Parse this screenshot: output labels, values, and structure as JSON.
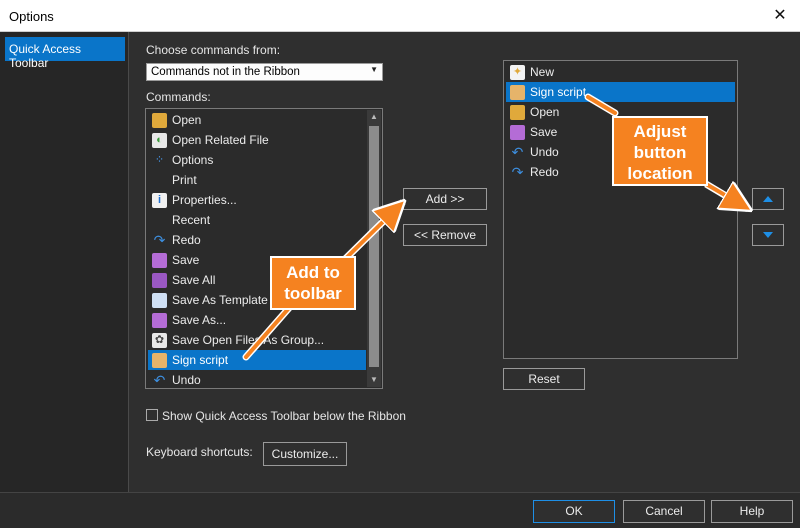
{
  "window": {
    "title": "Options",
    "close_glyph": "✕"
  },
  "nav": {
    "items": [
      {
        "label": "Quick Access Toolbar"
      }
    ]
  },
  "main": {
    "choose_label": "Choose commands from:",
    "choose_value": "Commands not in the Ribbon",
    "commands_label": "Commands:",
    "commands": [
      {
        "label": "Open",
        "icon": "folder-icon"
      },
      {
        "label": "Open Related File",
        "icon": "related-file-icon"
      },
      {
        "label": "Options",
        "icon": "options-icon"
      },
      {
        "label": "Print",
        "icon": ""
      },
      {
        "label": "Properties...",
        "icon": "properties-icon"
      },
      {
        "label": "Recent",
        "icon": ""
      },
      {
        "label": "Redo",
        "icon": "redo-icon"
      },
      {
        "label": "Save",
        "icon": "save-icon"
      },
      {
        "label": "Save All",
        "icon": "save-all-icon"
      },
      {
        "label": "Save As Template",
        "icon": "template-icon"
      },
      {
        "label": "Save As...",
        "icon": "save-as-icon"
      },
      {
        "label": "Save Open Files As Group...",
        "icon": "group-icon"
      },
      {
        "label": "Sign script",
        "icon": "sign-script-icon",
        "selected": true
      },
      {
        "label": "Undo",
        "icon": "undo-icon"
      }
    ],
    "add_label": "Add >>",
    "remove_label": "<< Remove",
    "toolbar_items": [
      {
        "label": "New",
        "icon": "new-icon"
      },
      {
        "label": "Sign script",
        "icon": "sign-script-icon",
        "selected": true
      },
      {
        "label": "Open",
        "icon": "folder-icon"
      },
      {
        "label": "Save",
        "icon": "save-icon"
      },
      {
        "label": "Undo",
        "icon": "undo-icon"
      },
      {
        "label": "Redo",
        "icon": "redo-icon"
      }
    ],
    "reset_label": "Reset",
    "show_below_label": "Show Quick Access Toolbar below the Ribbon",
    "keyboard_label": "Keyboard shortcuts:",
    "customize_label": "Customize..."
  },
  "footer": {
    "ok_label": "OK",
    "cancel_label": "Cancel",
    "help_label": "Help"
  },
  "annotations": {
    "add_to_toolbar": "Add to toolbar",
    "adjust_location": "Adjust button location",
    "color": "#f58220"
  },
  "colors": {
    "accent": "#0a75c9",
    "background": "#2f2f2f"
  }
}
